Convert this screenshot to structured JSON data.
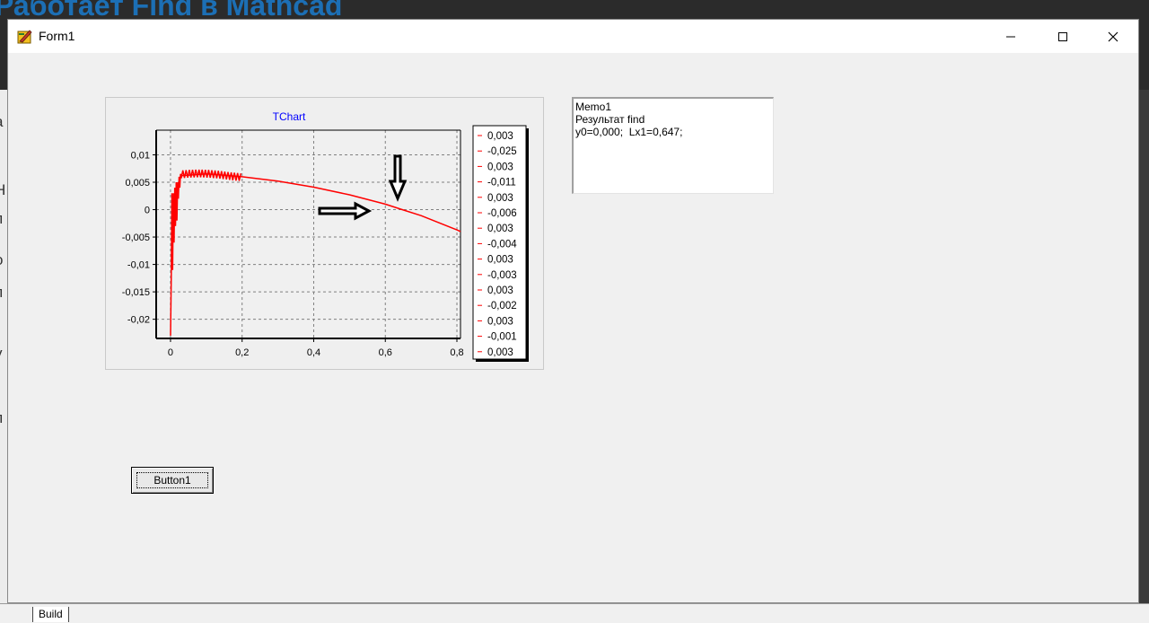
{
  "background": {
    "heading": "Работает Find в Mathcad",
    "side_fragments": [
      "a",
      "Н",
      "п",
      "о",
      "п",
      "у",
      "f",
      "п",
      "t"
    ],
    "bottom_tab": "Build"
  },
  "window": {
    "title": "Form1",
    "icon": "delphi-app-icon",
    "controls": [
      "minimize-icon",
      "maximize-icon",
      "close-icon"
    ]
  },
  "memo": {
    "lines": [
      "Memo1",
      "Результат find",
      "y0=0,000;  Lx1=0,647;"
    ]
  },
  "button": {
    "label": "Button1"
  },
  "chart_data": {
    "type": "line",
    "title": "TChart",
    "xlabel": "",
    "ylabel": "",
    "xlim": [
      -0.04,
      0.81
    ],
    "ylim": [
      -0.0235,
      0.0145
    ],
    "x_ticks": [
      "0",
      "0,2",
      "0,4",
      "0,6",
      "0,8"
    ],
    "x_tick_values": [
      0,
      0.2,
      0.4,
      0.6,
      0.8
    ],
    "y_ticks": [
      "0,01",
      "0,005",
      "0",
      "-0,005",
      "-0,01",
      "-0,015",
      "-0,02"
    ],
    "y_tick_values": [
      0.01,
      0.005,
      0,
      -0.005,
      -0.01,
      -0.015,
      -0.02
    ],
    "grid": true,
    "series_color": "#ff0000",
    "title_color": "#0000ff",
    "legend_position": "right",
    "legend": [
      "0,003",
      "-0,025",
      "0,003",
      "-0,011",
      "0,003",
      "-0,006",
      "0,003",
      "-0,004",
      "0,003",
      "-0,003",
      "0,003",
      "-0,002",
      "0,003",
      "-0,001",
      "0,003"
    ],
    "curve": {
      "description": "rapid oscillation near x=0 then smooth decay",
      "smooth_points": [
        [
          0.03,
          0.0062
        ],
        [
          0.1,
          0.0065
        ],
        [
          0.15,
          0.0063
        ],
        [
          0.2,
          0.006
        ],
        [
          0.3,
          0.0052
        ],
        [
          0.4,
          0.0041
        ],
        [
          0.5,
          0.0027
        ],
        [
          0.6,
          0.001
        ],
        [
          0.647,
          0.0
        ],
        [
          0.7,
          -0.0011
        ],
        [
          0.8,
          -0.0037
        ],
        [
          0.81,
          -0.004
        ]
      ],
      "oscillation_points": [
        [
          0.0,
          -0.023
        ],
        [
          0.002,
          -0.012
        ],
        [
          0.004,
          0.003
        ],
        [
          0.006,
          -0.011
        ],
        [
          0.008,
          0.003
        ],
        [
          0.01,
          -0.006
        ],
        [
          0.012,
          0.004
        ],
        [
          0.014,
          -0.003
        ],
        [
          0.016,
          0.005
        ],
        [
          0.018,
          -0.002
        ],
        [
          0.02,
          0.005
        ],
        [
          0.022,
          0.002
        ],
        [
          0.024,
          0.006
        ],
        [
          0.026,
          0.004
        ],
        [
          0.028,
          0.0065
        ],
        [
          0.03,
          0.0062
        ]
      ]
    },
    "annotations": [
      "right-arrow-marker",
      "down-arrow-marker"
    ]
  }
}
